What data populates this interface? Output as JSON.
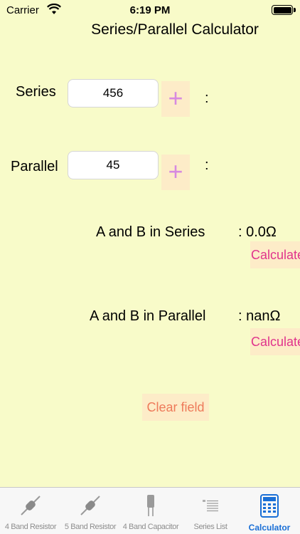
{
  "status_bar": {
    "carrier": "Carrier",
    "time": "6:19 PM"
  },
  "title": "Series/Parallel Calculator",
  "series": {
    "label": "Series",
    "value": "456",
    "plus": "+",
    "colon": ":"
  },
  "parallel": {
    "label": "Parallel",
    "value": "45",
    "plus": "+",
    "colon": ":"
  },
  "results": {
    "series": {
      "label": "A and B in Series",
      "value": ": 0.0Ω",
      "button": "Calculate"
    },
    "parallel": {
      "label": "A and B in Parallel",
      "value": ": nanΩ",
      "button": "Calculate"
    }
  },
  "clear_button": "Clear field",
  "tabs": [
    {
      "label": "4 Band Resistor",
      "icon": "resistor-icon"
    },
    {
      "label": "5 Band Resistor",
      "icon": "resistor-icon"
    },
    {
      "label": "4 Band Capacitor",
      "icon": "capacitor-icon"
    },
    {
      "label": "Series List",
      "icon": "list-icon"
    },
    {
      "label": "Calculator",
      "icon": "calculator-icon",
      "active": true
    }
  ],
  "colors": {
    "background": "#f8fbc9",
    "button_bg": "#fdecc8",
    "plus": "#d78ae0",
    "calc_text": "#e0338c",
    "clear_text": "#ee7a5a",
    "active_tab": "#1a6fd6"
  }
}
